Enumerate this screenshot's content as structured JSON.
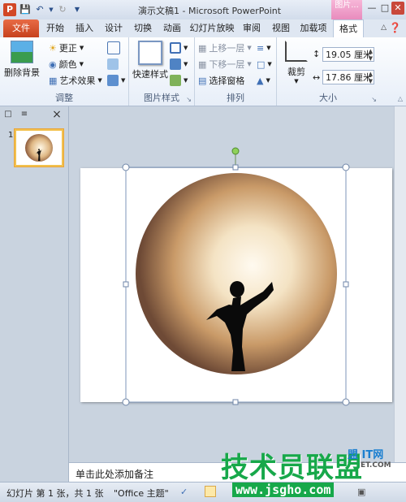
{
  "window": {
    "title": "演示文稿1 - Microsoft PowerPoint",
    "context_tab_title": "图片...",
    "app_icon": "P"
  },
  "tabs": [
    "文件",
    "开始",
    "插入",
    "设计",
    "切换",
    "动画",
    "幻灯片放映",
    "审阅",
    "视图",
    "加载项",
    "格式"
  ],
  "ribbon": {
    "adjust": {
      "label": "调整",
      "remove_bg": "删除背景",
      "corrections": "更正",
      "color": "颜色",
      "art_effects": "艺术效果"
    },
    "picture_styles": {
      "label": "图片样式",
      "quick_styles": "快速样式"
    },
    "arrange": {
      "label": "排列",
      "bring_forward": "上移一层",
      "send_backward": "下移一层",
      "selection_pane": "选择窗格"
    },
    "size": {
      "label": "大小",
      "crop": "裁剪",
      "height": "19.05 厘米",
      "width": "17.86 厘米"
    }
  },
  "slides_panel": {
    "slide_number": "1"
  },
  "notes": {
    "placeholder": "单击此处添加备注"
  },
  "status": {
    "slide_info": "幻灯片 第 1 张，共 1 张",
    "theme": "\"Office 主题\""
  },
  "watermark": {
    "main": "技术员联盟",
    "url": "www.jsgho.com",
    "partial": "ET.COM",
    "partial_top": "盟 IT网"
  }
}
